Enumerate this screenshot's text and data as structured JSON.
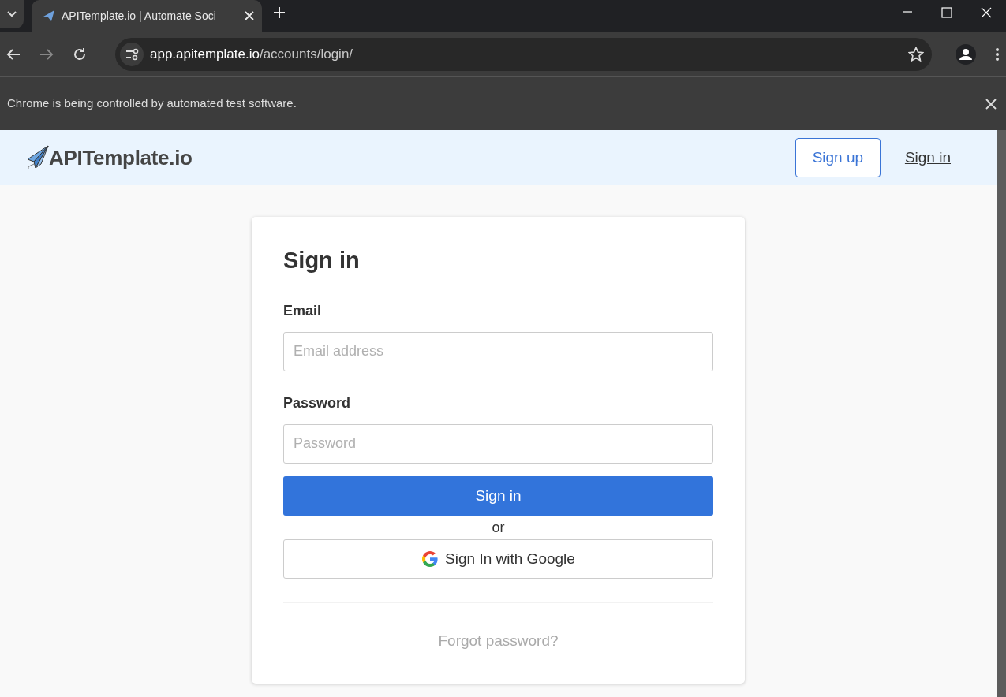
{
  "browser": {
    "tab_title": "APITemplate.io | Automate Soci",
    "url_host": "app.apitemplate.io",
    "url_path": "/accounts/login/",
    "infobar": "Chrome is being controlled by automated test software."
  },
  "site": {
    "logo": "APITemplate.io",
    "nav": [
      {
        "label": "Sign up",
        "kind": "outline"
      },
      {
        "label": "Sign in",
        "kind": "link"
      }
    ]
  },
  "form": {
    "title": "Sign in",
    "fields": [
      {
        "label": "Email",
        "placeholder": "Email address"
      },
      {
        "label": "Password",
        "placeholder": "Password"
      }
    ],
    "submit": "Sign in",
    "separator": "or",
    "google_button": "Sign In with Google",
    "forgot": "Forgot password?"
  }
}
